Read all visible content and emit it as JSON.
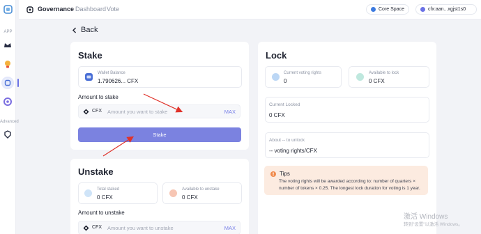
{
  "rail": {
    "app_label": "APP",
    "advanced_label": "Advanced",
    "colors": {
      "active": "#6b72e6"
    }
  },
  "topbar": {
    "title": "Governance",
    "nav": [
      "Dashboard",
      "Vote"
    ],
    "network": "Core Space",
    "account": "cfx:aan...xgjst1s0"
  },
  "back_label": "Back",
  "stake": {
    "title": "Stake",
    "wallet_label": "Wallet Balance",
    "wallet_value": "1.790626... CFX",
    "amount_label": "Amount to stake",
    "token": "CFX",
    "placeholder": "Amount you want to stake",
    "max": "MAX",
    "button": "Stake"
  },
  "unstake": {
    "title": "Unstake",
    "total_label": "Total staked",
    "total_value": "0 CFX",
    "available_label": "Available to unstake",
    "available_value": "0 CFX",
    "amount_label": "Amount to unstake",
    "token": "CFX",
    "placeholder": "Amount you want to unstake",
    "max": "MAX"
  },
  "lock": {
    "title": "Lock",
    "voting_label": "Current voting rights",
    "voting_value": "0",
    "available_label": "Available to lock",
    "available_value": "0 CFX",
    "locked_label": "Current Locked",
    "locked_value": "0 CFX",
    "unlock_label": "About -- to unlock",
    "unlock_value": "-- voting rights/CFX",
    "tips_title": "Tips",
    "tips_body": "The voting rights will be awarded according to: number of quarters × number of tokens × 0.25. The longest lock duration for voting is 1 year."
  },
  "watermark": {
    "line1": "激活 Windows",
    "line2": "转到\"设置\"以激活 Windows。"
  }
}
